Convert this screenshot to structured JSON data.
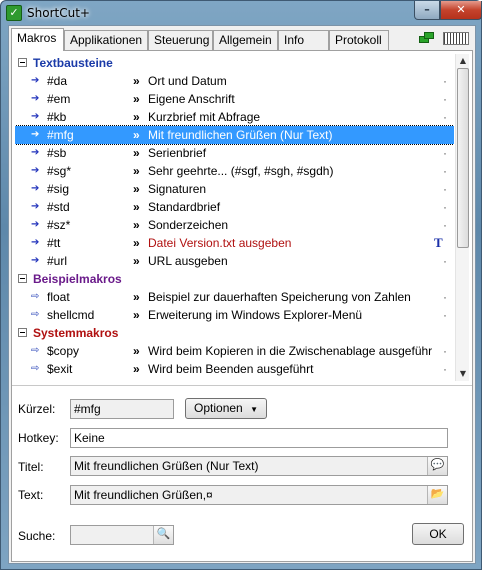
{
  "window": {
    "title": "ShortCut+",
    "minimize_glyph": "–",
    "close_glyph": "✕"
  },
  "tabs": [
    "Makros",
    "Applikationen",
    "Steuerung",
    "Allgemein",
    "Info",
    "Protokoll"
  ],
  "tab_icons": [
    "sync-icon",
    "barcode-icon"
  ],
  "tree": {
    "groups": [
      {
        "label": "Textbausteine",
        "color": "#1a3aa8",
        "items": [
          {
            "code": "#da",
            "desc": "Ort und Datum"
          },
          {
            "code": "#em",
            "desc": "Eigene Anschrift"
          },
          {
            "code": "#kb",
            "desc": "Kurzbrief mit Abfrage"
          },
          {
            "code": "#mfg",
            "desc": "Mit freundlichen Grüßen (Nur Text)",
            "selected": true
          },
          {
            "code": "#sb",
            "desc": "Serienbrief"
          },
          {
            "code": "#sg*",
            "desc": "Sehr geehrte... (#sgf, #sgh, #sgdh)"
          },
          {
            "code": "#sig",
            "desc": "Signaturen"
          },
          {
            "code": "#std",
            "desc": "Standardbrief"
          },
          {
            "code": "#sz*",
            "desc": "Sonderzeichen"
          },
          {
            "code": "#tt",
            "desc": "Datei Version.txt ausgeben",
            "desc_color": "#b01010",
            "mark": "T"
          },
          {
            "code": "#url",
            "desc": "URL ausgeben"
          }
        ]
      },
      {
        "label": "Beispielmakros",
        "color": "#6a1a8a",
        "items": [
          {
            "code": "float",
            "desc": "Beispiel zur dauerhaften Speicherung von Zahlen"
          },
          {
            "code": "shellcmd",
            "desc": "Erweiterung im Windows Explorer-Menü"
          }
        ]
      },
      {
        "label": "Systemmakros",
        "color": "#b01010",
        "items": [
          {
            "code": "$copy",
            "desc": "Wird beim Kopieren in die Zwischenablage ausgeführ"
          },
          {
            "code": "$exit",
            "desc": "Wird beim Beenden ausgeführt"
          }
        ]
      }
    ],
    "bullet": "»",
    "dot": "·"
  },
  "form": {
    "kuerzel_label": "Kürzel:",
    "kuerzel_value": "#mfg",
    "optionen_label": "Optionen",
    "hotkey_label": "Hotkey:",
    "hotkey_value": "Keine",
    "titel_label": "Titel:",
    "titel_value": "Mit freundlichen Grüßen (Nur Text)",
    "text_label": "Text:",
    "text_value": "Mit freundlichen Grüßen,¤",
    "suche_label": "Suche:",
    "suche_value": "",
    "ok_label": "OK"
  }
}
